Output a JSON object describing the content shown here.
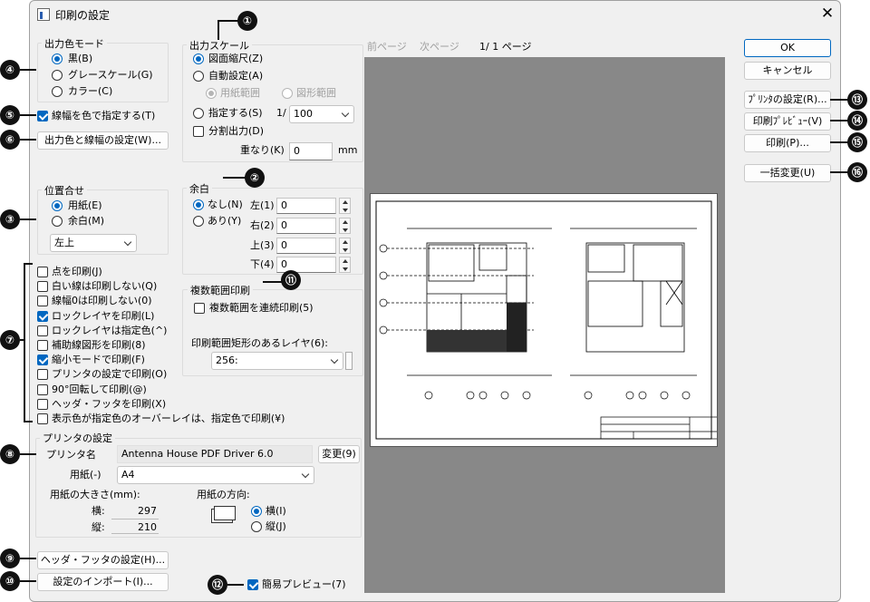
{
  "window": {
    "title": "印刷の設定"
  },
  "output_color": {
    "title": "出力色モード",
    "options": [
      "黒(B)",
      "グレースケール(G)",
      "カラー(C)"
    ],
    "selected": 0
  },
  "line_width_color_check": "線幅を色で指定する(T)",
  "output_color_width_button": "出力色と線幅の設定(W)...",
  "output_scale": {
    "title": "出力スケール",
    "fit": "図面縮尺(Z)",
    "auto": "自動設定(A)",
    "paper_range": "用紙範囲",
    "figure_range": "図形範囲",
    "specify": "指定する(S)",
    "ratio_prefix": "1/",
    "ratio_value": "100",
    "split_output": "分割出力(D)",
    "overlap_label": "重なり(K)",
    "overlap_value": "0",
    "overlap_unit": "mm"
  },
  "position": {
    "title": "位置合せ",
    "options": [
      "用紙(E)",
      "余白(M)"
    ],
    "align_value": "左上"
  },
  "margin": {
    "title": "余白",
    "none": "なし(N)",
    "yes": "あり(Y)",
    "left_label": "左(1)",
    "left_value": "0",
    "right_label": "右(2)",
    "right_value": "0",
    "top_label": "上(3)",
    "top_value": "0",
    "bottom_label": "下(4)",
    "bottom_value": "0"
  },
  "multi_range": {
    "title": "複数範囲印刷",
    "continuous": "複数範囲を連続印刷(5)",
    "layer_label": "印刷範囲矩形のあるレイヤ(6):",
    "layer_value": "256:"
  },
  "options": [
    {
      "label": "点を印刷(J)",
      "checked": false
    },
    {
      "label": "白い線は印刷しない(Q)",
      "checked": false
    },
    {
      "label": "線幅0は印刷しない(0)",
      "checked": false
    },
    {
      "label": "ロックレイヤを印刷(L)",
      "checked": true
    },
    {
      "label": "ロックレイヤは指定色(^)",
      "checked": false
    },
    {
      "label": "補助線図形を印刷(8)",
      "checked": false
    },
    {
      "label": "縮小モードで印刷(F)",
      "checked": true
    },
    {
      "label": "プリンタの設定で印刷(O)",
      "checked": false
    },
    {
      "label": "90°回転して印刷(@)",
      "checked": false
    },
    {
      "label": "ヘッダ・フッタを印刷(X)",
      "checked": false
    },
    {
      "label": "表示色が指定色のオーバーレイは、指定色で印刷(¥)",
      "checked": false
    }
  ],
  "printer": {
    "title": "プリンタの設定",
    "name_label": "プリンタ名",
    "name_value": "Antenna House PDF Driver 6.0",
    "change_button": "変更(9)",
    "paper_label": "用紙(-)",
    "paper_value": "A4",
    "size_label": "用紙の大きさ(mm):",
    "width_label": "横:",
    "width_value": "297",
    "height_label": "縦:",
    "height_value": "210",
    "orientation_label": "用紙の方向:",
    "landscape": "横(I)",
    "portrait": "縦(J)"
  },
  "header_footer_button": "ヘッダ・フッタの設定(H)...",
  "import_button": "設定のインポート(I)...",
  "simple_preview": "簡易プレビュー(7)",
  "nav": {
    "prev": "前ページ",
    "next": "次ページ",
    "page": "1/ 1 ページ"
  },
  "buttons": {
    "ok": "OK",
    "cancel": "キャンセル",
    "printer_settings": "ﾌﾟﾘﾝﾀの設定(R)...",
    "print_preview": "印刷ﾌﾟﾚﾋﾞｭｰ(V)",
    "print": "印刷(P)...",
    "batch_change": "一括変更(U)"
  },
  "callouts": [
    "①",
    "②",
    "③",
    "④",
    "⑤",
    "⑥",
    "⑦",
    "⑧",
    "⑨",
    "⑩",
    "⑪",
    "⑫",
    "⑬",
    "⑭",
    "⑮",
    "⑯"
  ],
  "colors": {
    "accent": "#0067c0",
    "preview_bg": "#888888"
  }
}
